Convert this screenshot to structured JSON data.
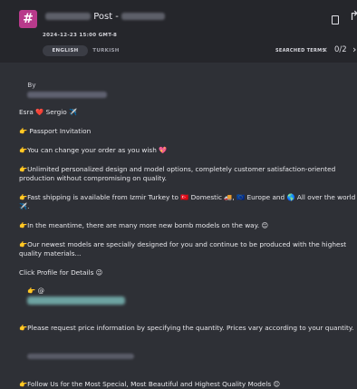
{
  "header": {
    "logo_char": "#",
    "post_label": "Post -",
    "date": "2024-12-23 15:00 GMT-8",
    "tabs": [
      {
        "label": "ENGLISH",
        "active": true
      },
      {
        "label": "TURKISH",
        "active": false
      }
    ],
    "searched_terms_label": "SEARCHED TERMS",
    "prev": "‹",
    "counter": "0/2",
    "next": "›",
    "bookmark_icon": "bookmark-icon",
    "share_icon": "share-icon",
    "accent_color": "#b83a8b"
  },
  "post": {
    "by": "By",
    "lines": [
      "Esra ❤️ Sergio ✈️",
      "👉 Passport Invitation",
      "👉You can change your order as you wish 💖",
      "👉Unlimited personalized design and model options, completely customer satisfaction-oriented production without compromising on quality.",
      "👉Fast shipping is available from Izmir Turkey to 🇹🇷 Domestic 🚚, 🇪🇺 Europe and 🌎 All over the world ✈️.",
      "👉In the meantime, there are many more new bomb models on the way. 😊",
      "👉Our newest models are specially designed for you and continue to be produced with the highest quality materials...",
      "Click Profile for Details 😉",
      "👉 @",
      "👉Please request price information by specifying the quantity. Prices vary according to your quantity.",
      "👉Follow Us for the Most Special, Most Beautiful and Highest Quality Models 😊"
    ]
  }
}
